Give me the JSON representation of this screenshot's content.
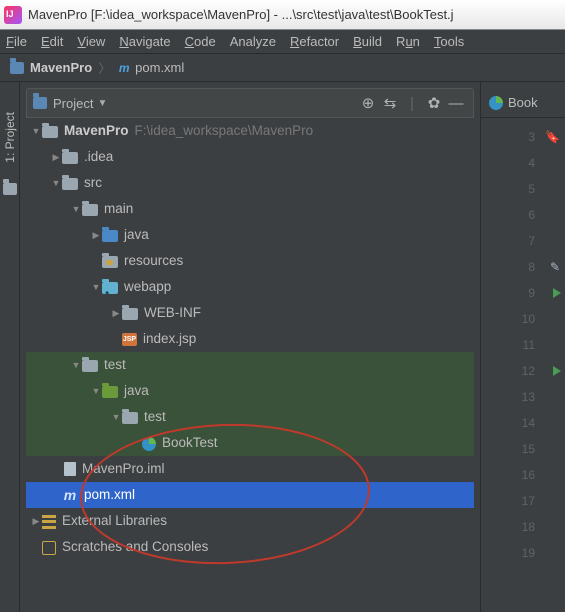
{
  "title": "MavenPro [F:\\idea_workspace\\MavenPro] - ...\\src\\test\\java\\test\\BookTest.j",
  "menu": {
    "file": "File",
    "edit": "Edit",
    "view": "View",
    "navigate": "Navigate",
    "code": "Code",
    "analyze": "Analyze",
    "refactor": "Refactor",
    "build": "Build",
    "run": "Run",
    "tools": "Tools"
  },
  "breadcrumb": {
    "root": "MavenPro",
    "file": "pom.xml"
  },
  "sidetab": {
    "project": "1: Project"
  },
  "panehead": {
    "label": "Project"
  },
  "tree": {
    "root": {
      "name": "MavenPro",
      "path": "F:\\idea_workspace\\MavenPro"
    },
    "idea": ".idea",
    "src": "src",
    "main": "main",
    "java": "java",
    "resources": "resources",
    "webapp": "webapp",
    "webinf": "WEB-INF",
    "indexjsp": "index.jsp",
    "test": "test",
    "testjava": "java",
    "testpkg": "test",
    "booktest": "BookTest",
    "iml": "MavenPro.iml",
    "pom": "pom.xml",
    "ext": "External Libraries",
    "scratch": "Scratches and Consoles"
  },
  "editor": {
    "tab": "Book",
    "lines": [
      3,
      4,
      5,
      6,
      7,
      8,
      9,
      10,
      11,
      12,
      13,
      14,
      15,
      16,
      17,
      18,
      19
    ]
  }
}
